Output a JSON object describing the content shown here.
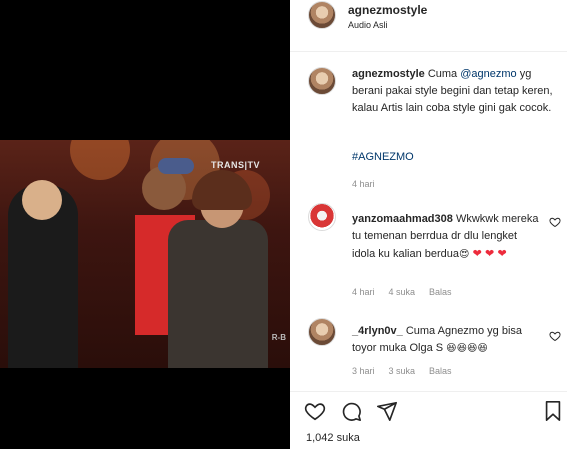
{
  "post": {
    "username": "agnezmostyle",
    "audio": "Audio Asli",
    "video_watermark": "TRANS|TV",
    "video_watermark_bottom": "R-B"
  },
  "caption": {
    "username": "agnezmostyle",
    "text_prefix": "Cuma ",
    "mention": "@agnezmo",
    "text_suffix": " yg berani pakai style begini dan tetap keren, kalau Artis lain coba style gini gak cocok.",
    "hashtag": "#AGNEZMO",
    "time": "4 hari"
  },
  "comments": [
    {
      "username": "yanzomaahmad308",
      "text": "Wkwkwk mereka tu temenan berrdua dr dlu lengket idola ku kalian berdua",
      "emoji": "😍 ❤ ❤ ❤",
      "time": "4 hari",
      "likes": "4 suka",
      "reply": "Balas"
    },
    {
      "username": "_4rlyn0v_",
      "text": "Cuma Agnezmo yg bisa toyor muka Olga S",
      "emoji": "😆😆😆😆",
      "time": "3 hari",
      "likes": "3 suka",
      "reply": "Balas"
    }
  ],
  "actions": {
    "like_icon": "heart-icon",
    "comment_icon": "comment-bubble-icon",
    "share_icon": "paper-plane-icon",
    "save_icon": "bookmark-icon",
    "likes_count": "1,042 suka"
  },
  "colors": {
    "text": "#262626",
    "muted": "#8e8e8e",
    "link": "#00376b",
    "heart": "#ed2b3c",
    "border": "#efefef"
  }
}
